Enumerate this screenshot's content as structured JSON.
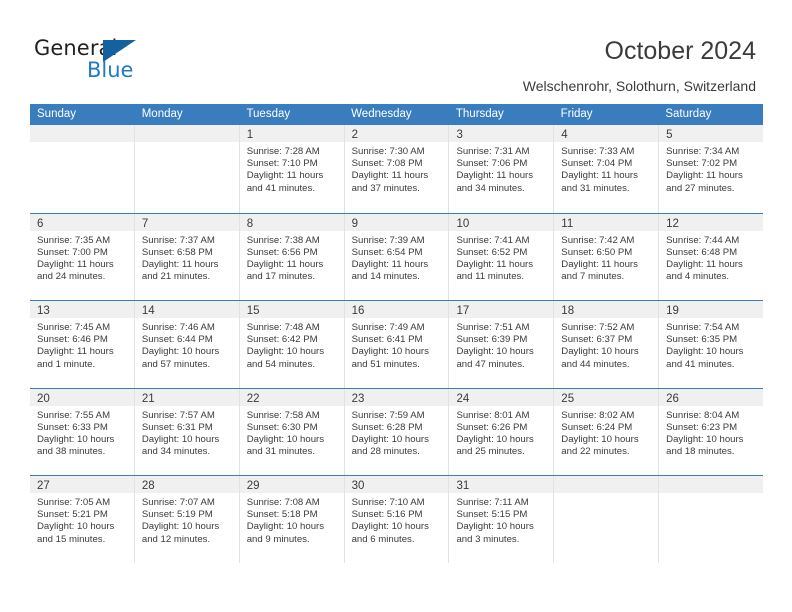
{
  "brand": {
    "logo_word_1": "General",
    "logo_word_2": "Blue",
    "triangle_icon": "triangle-icon",
    "accent_color": "#3a7dbf",
    "logo_blue": "#1d7cc4"
  },
  "header": {
    "title": "October 2024",
    "subtitle": "Welschenrohr, Solothurn, Switzerland"
  },
  "calendar": {
    "weekdays": [
      "Sunday",
      "Monday",
      "Tuesday",
      "Wednesday",
      "Thursday",
      "Friday",
      "Saturday"
    ],
    "labels": {
      "sunrise": "Sunrise:",
      "sunset": "Sunset:",
      "daylight": "Daylight:"
    },
    "weeks": [
      [
        {
          "day": ""
        },
        {
          "day": ""
        },
        {
          "day": "1",
          "sunrise": "Sunrise: 7:28 AM",
          "sunset": "Sunset: 7:10 PM",
          "daylight_1": "Daylight: 11 hours",
          "daylight_2": "and 41 minutes."
        },
        {
          "day": "2",
          "sunrise": "Sunrise: 7:30 AM",
          "sunset": "Sunset: 7:08 PM",
          "daylight_1": "Daylight: 11 hours",
          "daylight_2": "and 37 minutes."
        },
        {
          "day": "3",
          "sunrise": "Sunrise: 7:31 AM",
          "sunset": "Sunset: 7:06 PM",
          "daylight_1": "Daylight: 11 hours",
          "daylight_2": "and 34 minutes."
        },
        {
          "day": "4",
          "sunrise": "Sunrise: 7:33 AM",
          "sunset": "Sunset: 7:04 PM",
          "daylight_1": "Daylight: 11 hours",
          "daylight_2": "and 31 minutes."
        },
        {
          "day": "5",
          "sunrise": "Sunrise: 7:34 AM",
          "sunset": "Sunset: 7:02 PM",
          "daylight_1": "Daylight: 11 hours",
          "daylight_2": "and 27 minutes."
        }
      ],
      [
        {
          "day": "6",
          "sunrise": "Sunrise: 7:35 AM",
          "sunset": "Sunset: 7:00 PM",
          "daylight_1": "Daylight: 11 hours",
          "daylight_2": "and 24 minutes."
        },
        {
          "day": "7",
          "sunrise": "Sunrise: 7:37 AM",
          "sunset": "Sunset: 6:58 PM",
          "daylight_1": "Daylight: 11 hours",
          "daylight_2": "and 21 minutes."
        },
        {
          "day": "8",
          "sunrise": "Sunrise: 7:38 AM",
          "sunset": "Sunset: 6:56 PM",
          "daylight_1": "Daylight: 11 hours",
          "daylight_2": "and 17 minutes."
        },
        {
          "day": "9",
          "sunrise": "Sunrise: 7:39 AM",
          "sunset": "Sunset: 6:54 PM",
          "daylight_1": "Daylight: 11 hours",
          "daylight_2": "and 14 minutes."
        },
        {
          "day": "10",
          "sunrise": "Sunrise: 7:41 AM",
          "sunset": "Sunset: 6:52 PM",
          "daylight_1": "Daylight: 11 hours",
          "daylight_2": "and 11 minutes."
        },
        {
          "day": "11",
          "sunrise": "Sunrise: 7:42 AM",
          "sunset": "Sunset: 6:50 PM",
          "daylight_1": "Daylight: 11 hours",
          "daylight_2": "and 7 minutes."
        },
        {
          "day": "12",
          "sunrise": "Sunrise: 7:44 AM",
          "sunset": "Sunset: 6:48 PM",
          "daylight_1": "Daylight: 11 hours",
          "daylight_2": "and 4 minutes."
        }
      ],
      [
        {
          "day": "13",
          "sunrise": "Sunrise: 7:45 AM",
          "sunset": "Sunset: 6:46 PM",
          "daylight_1": "Daylight: 11 hours",
          "daylight_2": "and 1 minute."
        },
        {
          "day": "14",
          "sunrise": "Sunrise: 7:46 AM",
          "sunset": "Sunset: 6:44 PM",
          "daylight_1": "Daylight: 10 hours",
          "daylight_2": "and 57 minutes."
        },
        {
          "day": "15",
          "sunrise": "Sunrise: 7:48 AM",
          "sunset": "Sunset: 6:42 PM",
          "daylight_1": "Daylight: 10 hours",
          "daylight_2": "and 54 minutes."
        },
        {
          "day": "16",
          "sunrise": "Sunrise: 7:49 AM",
          "sunset": "Sunset: 6:41 PM",
          "daylight_1": "Daylight: 10 hours",
          "daylight_2": "and 51 minutes."
        },
        {
          "day": "17",
          "sunrise": "Sunrise: 7:51 AM",
          "sunset": "Sunset: 6:39 PM",
          "daylight_1": "Daylight: 10 hours",
          "daylight_2": "and 47 minutes."
        },
        {
          "day": "18",
          "sunrise": "Sunrise: 7:52 AM",
          "sunset": "Sunset: 6:37 PM",
          "daylight_1": "Daylight: 10 hours",
          "daylight_2": "and 44 minutes."
        },
        {
          "day": "19",
          "sunrise": "Sunrise: 7:54 AM",
          "sunset": "Sunset: 6:35 PM",
          "daylight_1": "Daylight: 10 hours",
          "daylight_2": "and 41 minutes."
        }
      ],
      [
        {
          "day": "20",
          "sunrise": "Sunrise: 7:55 AM",
          "sunset": "Sunset: 6:33 PM",
          "daylight_1": "Daylight: 10 hours",
          "daylight_2": "and 38 minutes."
        },
        {
          "day": "21",
          "sunrise": "Sunrise: 7:57 AM",
          "sunset": "Sunset: 6:31 PM",
          "daylight_1": "Daylight: 10 hours",
          "daylight_2": "and 34 minutes."
        },
        {
          "day": "22",
          "sunrise": "Sunrise: 7:58 AM",
          "sunset": "Sunset: 6:30 PM",
          "daylight_1": "Daylight: 10 hours",
          "daylight_2": "and 31 minutes."
        },
        {
          "day": "23",
          "sunrise": "Sunrise: 7:59 AM",
          "sunset": "Sunset: 6:28 PM",
          "daylight_1": "Daylight: 10 hours",
          "daylight_2": "and 28 minutes."
        },
        {
          "day": "24",
          "sunrise": "Sunrise: 8:01 AM",
          "sunset": "Sunset: 6:26 PM",
          "daylight_1": "Daylight: 10 hours",
          "daylight_2": "and 25 minutes."
        },
        {
          "day": "25",
          "sunrise": "Sunrise: 8:02 AM",
          "sunset": "Sunset: 6:24 PM",
          "daylight_1": "Daylight: 10 hours",
          "daylight_2": "and 22 minutes."
        },
        {
          "day": "26",
          "sunrise": "Sunrise: 8:04 AM",
          "sunset": "Sunset: 6:23 PM",
          "daylight_1": "Daylight: 10 hours",
          "daylight_2": "and 18 minutes."
        }
      ],
      [
        {
          "day": "27",
          "sunrise": "Sunrise: 7:05 AM",
          "sunset": "Sunset: 5:21 PM",
          "daylight_1": "Daylight: 10 hours",
          "daylight_2": "and 15 minutes."
        },
        {
          "day": "28",
          "sunrise": "Sunrise: 7:07 AM",
          "sunset": "Sunset: 5:19 PM",
          "daylight_1": "Daylight: 10 hours",
          "daylight_2": "and 12 minutes."
        },
        {
          "day": "29",
          "sunrise": "Sunrise: 7:08 AM",
          "sunset": "Sunset: 5:18 PM",
          "daylight_1": "Daylight: 10 hours",
          "daylight_2": "and 9 minutes."
        },
        {
          "day": "30",
          "sunrise": "Sunrise: 7:10 AM",
          "sunset": "Sunset: 5:16 PM",
          "daylight_1": "Daylight: 10 hours",
          "daylight_2": "and 6 minutes."
        },
        {
          "day": "31",
          "sunrise": "Sunrise: 7:11 AM",
          "sunset": "Sunset: 5:15 PM",
          "daylight_1": "Daylight: 10 hours",
          "daylight_2": "and 3 minutes."
        },
        {
          "day": ""
        },
        {
          "day": ""
        }
      ]
    ]
  }
}
